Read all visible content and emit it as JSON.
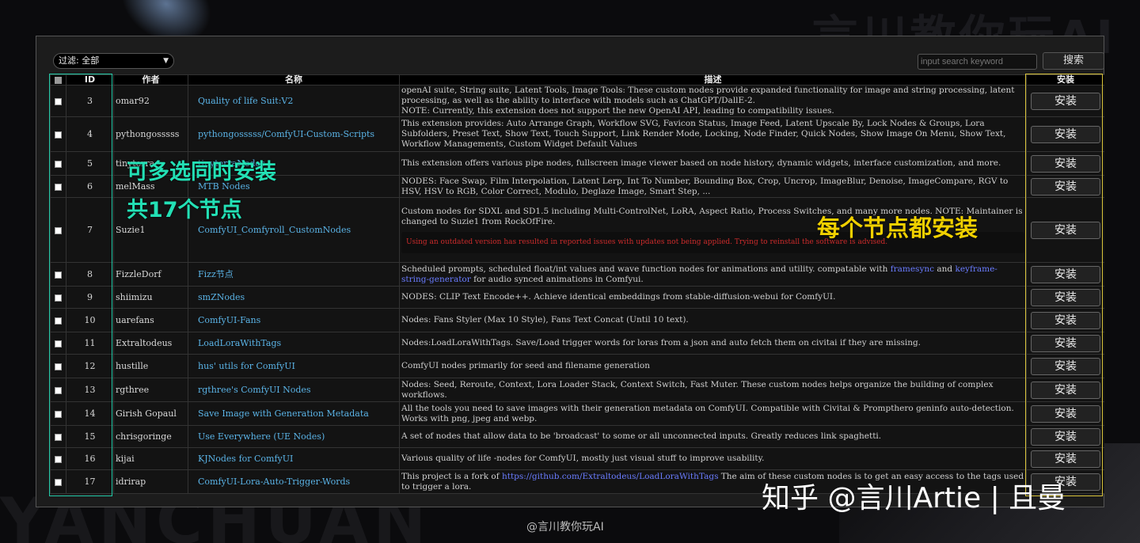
{
  "background": {
    "top_text": "言川教你玩AI",
    "bottom_text": "YANCHUAN"
  },
  "toolbar": {
    "filter_label": "过滤: 全部",
    "search_placeholder": "input search keyword",
    "search_button": "搜索"
  },
  "table": {
    "headers": {
      "id": "ID",
      "author": "作者",
      "name": "名称",
      "description": "描述",
      "install": "安装"
    },
    "install_label": "安装",
    "rows": [
      {
        "id": "3",
        "author": "omar92",
        "name": "Quality of life Suit:V2",
        "desc": "openAI suite, String suite, Latent Tools, Image Tools: These custom nodes provide expanded functionality for image and string processing, latent processing, as well as the ability to interface with models such as ChatGPT/DallE-2.\nNOTE: Currently, this extension does not support the new OpenAI API, leading to compatibility issues."
      },
      {
        "id": "4",
        "author": "pythongosssss",
        "name": "pythongosssss/ComfyUI-Custom-Scripts",
        "desc": "This extension provides: Auto Arrange Graph, Workflow SVG, Favicon Status, Image Feed, Latent Upscale By, Lock Nodes & Groups, Lora Subfolders, Preset Text, Show Text, Touch Support, Link Render Mode, Locking, Node Finder, Quick Nodes, Show Image On Menu, Show Text, Workflow Managements, Custom Widget Default Values"
      },
      {
        "id": "5",
        "author": "tinyterra",
        "name": "tinyterraNodes",
        "desc": "This extension offers various pipe nodes, fullscreen image viewer based on node history, dynamic widgets, interface customization, and more."
      },
      {
        "id": "6",
        "author": "melMass",
        "name": "MTB Nodes",
        "desc": "NODES: Face Swap, Film Interpolation, Latent Lerp, Int To Number, Bounding Box, Crop, Uncrop, ImageBlur, Denoise, ImageCompare, RGV to HSV, HSV to RGB, Color Correct, Modulo, Deglaze Image, Smart Step, ..."
      },
      {
        "id": "7",
        "author": "Suzie1",
        "name": "ComfyUI_Comfyroll_CustomNodes",
        "desc": "Custom nodes for SDXL and SD1.5 including Multi-ControlNet, LoRA, Aspect Ratio, Process Switches, and many more nodes. NOTE: Maintainer is changed to Suzie1 from RockOfFire.",
        "warning": "Using an outdated version has resulted in reported issues with updates not being applied. Trying to reinstall the software is advised."
      },
      {
        "id": "8",
        "author": "FizzleDorf",
        "name": "Fizz节点",
        "desc": "Scheduled prompts, scheduled float/int values and wave function nodes for animations and utility. compatable with ",
        "link1": "framesync",
        "mid": " and ",
        "link2": "keyframe-string-generator",
        "tail": " for audio synced animations in Comfyui."
      },
      {
        "id": "9",
        "author": "shiimizu",
        "name": "smZNodes",
        "desc": "NODES: CLIP Text Encode++. Achieve identical embeddings from stable-diffusion-webui for ComfyUI."
      },
      {
        "id": "10",
        "author": "uarefans",
        "name": "ComfyUI-Fans",
        "desc": "Nodes: Fans Styler (Max 10 Style), Fans Text Concat (Until 10 text)."
      },
      {
        "id": "11",
        "author": "Extraltodeus",
        "name": "LoadLoraWithTags",
        "desc": "Nodes:LoadLoraWithTags. Save/Load trigger words for loras from a json and auto fetch them on civitai if they are missing."
      },
      {
        "id": "12",
        "author": "hustille",
        "name": "hus' utils for ComfyUI",
        "desc": "ComfyUI nodes primarily for seed and filename generation"
      },
      {
        "id": "13",
        "author": "rgthree",
        "name": "rgthree's ComfyUI Nodes",
        "desc": "Nodes: Seed, Reroute, Context, Lora Loader Stack, Context Switch, Fast Muter. These custom nodes helps organize the building of complex workflows."
      },
      {
        "id": "14",
        "author": "Girish Gopaul",
        "name": "Save Image with Generation Metadata",
        "desc": "All the tools you need to save images with their generation metadata on ComfyUI. Compatible with Civitai & Prompthero geninfo auto-detection. Works with png, jpeg and webp."
      },
      {
        "id": "15",
        "author": "chrisgoringe",
        "name": "Use Everywhere (UE Nodes)",
        "desc": "A set of nodes that allow data to be 'broadcast' to some or all unconnected inputs. Greatly reduces link spaghetti."
      },
      {
        "id": "16",
        "author": "kijai",
        "name": "KJNodes for ComfyUI",
        "desc": "Various quality of life -nodes for ComfyUI, mostly just visual stuff to improve usability."
      },
      {
        "id": "17",
        "author": "idrirap",
        "name": "ComfyUI-Lora-Auto-Trigger-Words",
        "desc": "This project is a fork of ",
        "link1": "https://github.com/Extraltodeus/LoadLoraWithTags",
        "tail": " The aim of these custom nodes is to get an easy access to the tags used to trigger a lora."
      }
    ]
  },
  "annotations": {
    "multi_select": "可多选同时安装",
    "node_count": "共17个节点",
    "install_each": "每个节点都安装"
  },
  "watermark": {
    "zhihu": "知乎 @言川Artie | 且曼",
    "credit": "@言川教你玩AI"
  },
  "colors": {
    "green_highlight": "#22c7a5",
    "yellow_highlight": "#d9c33a",
    "link_blue": "#5ab3e6",
    "warning_red": "#cc2b2b"
  }
}
